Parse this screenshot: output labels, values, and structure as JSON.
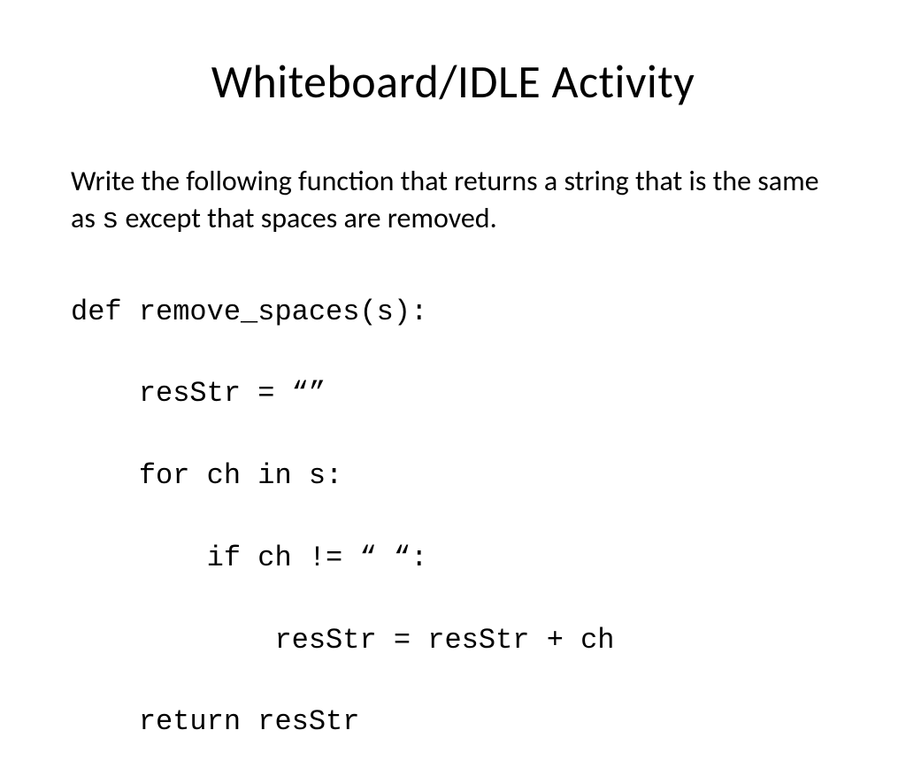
{
  "title": "Whiteboard/IDLE Activity",
  "prompt": {
    "part1": "Write the following function that returns a string that is the same as ",
    "code_inline": "s",
    "part2": " except that spaces are removed."
  },
  "code": {
    "line1": "def remove_spaces(s):",
    "line2": "    resStr = “”",
    "line3": "    for ch in s:",
    "line4": "        if ch != “ “:",
    "line5": "            resStr = resStr + ch",
    "line6": "    return resStr"
  }
}
